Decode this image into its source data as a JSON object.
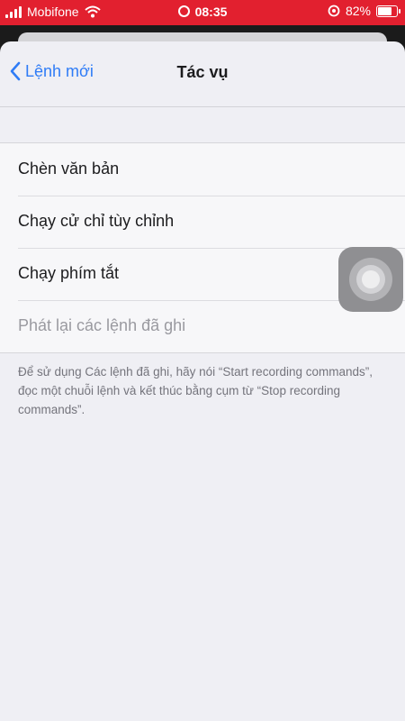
{
  "status_bar": {
    "carrier": "Mobifone",
    "time": "08:35",
    "battery": "82%",
    "battery_level": 0.82
  },
  "nav": {
    "back_label": "Lệnh mới",
    "title": "Tác vụ"
  },
  "actions": [
    {
      "label": "Chèn văn bản",
      "enabled": true
    },
    {
      "label": "Chạy cử chỉ tùy chỉnh",
      "enabled": true
    },
    {
      "label": "Chạy phím tắt",
      "enabled": true
    },
    {
      "label": "Phát lại các lệnh đã ghi",
      "enabled": false
    }
  ],
  "footer_text": "Để sử dụng Các lệnh đã ghi, hãy nói “Start recording commands”, đọc một chuỗi lệnh và kết thúc bằng cụm từ “Stop recording commands”.",
  "icons": [
    "signal-icon",
    "wifi-icon",
    "screen-record-icon",
    "orientation-lock-icon",
    "battery-icon",
    "chevron-left-icon",
    "assistive-touch-icon"
  ],
  "colors": {
    "status_bar": "#e2202f",
    "accent": "#2f7cf6"
  }
}
